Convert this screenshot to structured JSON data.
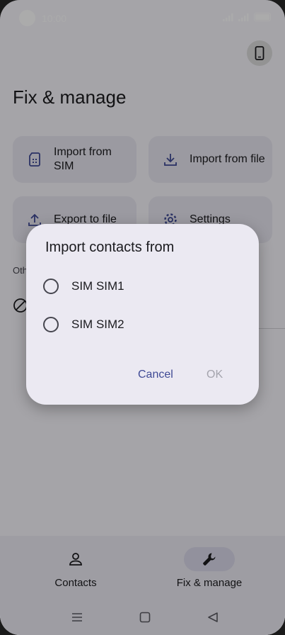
{
  "status_bar": {
    "time": "10:00"
  },
  "page": {
    "title": "Fix & manage"
  },
  "cards": [
    {
      "label": "Import from SIM",
      "icon": "sim-card-icon"
    },
    {
      "label": "Import from file",
      "icon": "download-icon"
    },
    {
      "label": "Export to file",
      "icon": "upload-icon"
    },
    {
      "label": "Settings",
      "icon": "gear-icon"
    }
  ],
  "other_section": {
    "label": "Oth"
  },
  "dialog": {
    "title": "Import contacts from",
    "options": [
      {
        "label": "SIM SIM1",
        "selected": false
      },
      {
        "label": "SIM SIM2",
        "selected": false
      }
    ],
    "cancel_label": "Cancel",
    "ok_label": "OK"
  },
  "bottom_nav": {
    "items": [
      {
        "label": "Contacts",
        "icon": "person-icon",
        "active": false
      },
      {
        "label": "Fix & manage",
        "icon": "wrench-icon",
        "active": true
      }
    ]
  },
  "colors": {
    "accent": "#3f4a95",
    "dialog_bg": "#ebe9f2",
    "disabled": "#a4a4ad"
  }
}
